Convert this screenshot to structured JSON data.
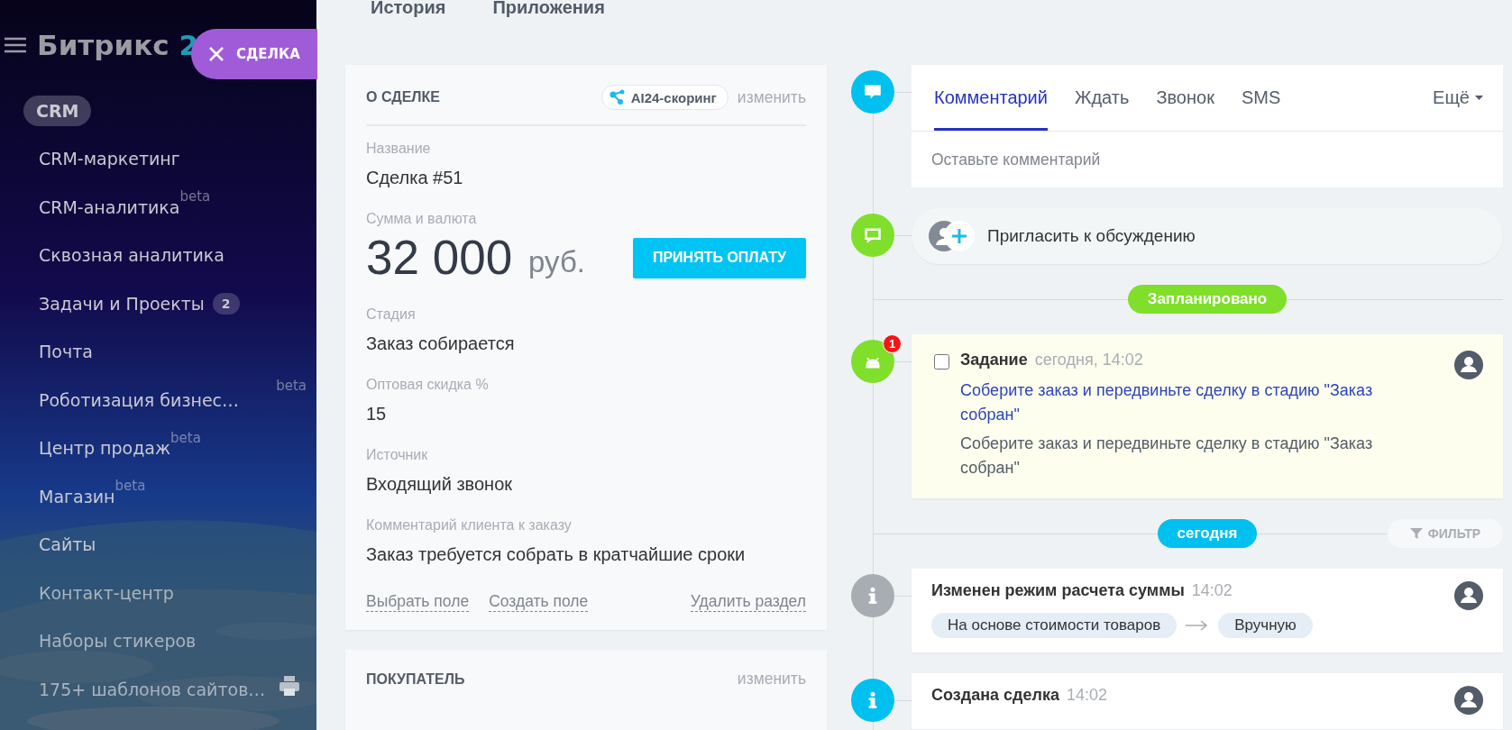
{
  "sidebar": {
    "logo": {
      "title": "Битрикс",
      "number": "2"
    },
    "items": [
      {
        "label": "CRM",
        "selected": true,
        "dimmed": false
      },
      {
        "label": "CRM-маркетинг",
        "selected": false,
        "dimmed": false
      },
      {
        "label": "CRM-аналитика",
        "superscript": "beta",
        "selected": false,
        "dimmed": false
      },
      {
        "label": "Сквозная аналитика",
        "selected": false,
        "dimmed": false
      },
      {
        "label": "Задачи и Проекты",
        "counter": "2",
        "selected": false,
        "dimmed": false
      },
      {
        "label": "Почта",
        "selected": false,
        "dimmed": false
      },
      {
        "label": "Роботизация бизнес…",
        "superscript": "beta",
        "superscript_right": true,
        "selected": false,
        "dimmed": false
      },
      {
        "label": "Центр продаж",
        "superscript": "beta",
        "selected": false,
        "dimmed": false
      },
      {
        "label": "Магазин",
        "superscript": "beta",
        "selected": false,
        "dimmed": false
      },
      {
        "label": "Сайты",
        "selected": false,
        "dimmed": false
      },
      {
        "label": "Контакт-центр",
        "selected": false,
        "dimmed": true
      },
      {
        "label": "Наборы стикеров",
        "selected": false,
        "dimmed": true
      },
      {
        "label": "175+ шаблонов сайтов…",
        "selected": false,
        "dimmed": true,
        "print_icon": true
      }
    ]
  },
  "deal_button": {
    "label": "СДЕЛКА"
  },
  "top_tabs": [
    "История",
    "Приложения"
  ],
  "deal_card": {
    "title": "О СДЕЛКЕ",
    "scoring": "AI24-скоринг",
    "edit": "изменить",
    "fields": [
      {
        "kind": "text",
        "label": "Название",
        "value": "Сделка #51"
      },
      {
        "kind": "amount",
        "label": "Сумма и валюта",
        "value": "32 000",
        "currency": "руб.",
        "button": "ПРИНЯТЬ ОПЛАТУ"
      },
      {
        "kind": "text",
        "label": "Стадия",
        "value": "Заказ собирается"
      },
      {
        "kind": "text",
        "label": "Оптовая скидка %",
        "value": "15"
      },
      {
        "kind": "text",
        "label": "Источник",
        "value": "Входящий звонок"
      },
      {
        "kind": "text",
        "label": "Комментарий клиента к заказу",
        "value": "Заказ требуется собрать в кратчайшие сроки"
      }
    ],
    "actions": [
      "Выбрать поле",
      "Создать поле"
    ],
    "delete": "Удалить раздел"
  },
  "buyer_card": {
    "title": "ПОКУПАТЕЛЬ",
    "edit": "изменить"
  },
  "timeline": [
    {
      "kind": "composer",
      "color": "#00c0ef",
      "tabs": [
        {
          "label": "Комментарий",
          "selected": true
        },
        {
          "label": "Ждать",
          "selected": false
        },
        {
          "label": "Звонок",
          "selected": false
        },
        {
          "label": "SMS",
          "selected": false
        }
      ],
      "more": "Ещё",
      "placeholder": "Оставьте комментарий"
    },
    {
      "kind": "invite",
      "color": "#7fdf2a",
      "label": "Пригласить к обсуждению"
    },
    {
      "kind": "divider",
      "color": "#7fdf2a",
      "label": "Запланировано"
    },
    {
      "kind": "task",
      "color": "#7fdf2a",
      "counter": "1",
      "checked": false,
      "title": "Задание",
      "time": "сегодня, 14:02",
      "link": "Соберите заказ и передвиньте сделку в стадию \"Заказ собран\"",
      "text": "Соберите заказ и передвиньте сделку в стадию \"Заказ собран\""
    },
    {
      "kind": "divider",
      "color": "#00c0ef",
      "label": "сегодня",
      "filter": "ФИЛЬТР"
    },
    {
      "kind": "event",
      "color": "#a8adb4",
      "title": "Изменен режим расчета суммы",
      "time": "14:02",
      "from": "На основе стоимости товаров",
      "to": "Вручную"
    },
    {
      "kind": "event",
      "color": "#00c0ef",
      "title": "Создана сделка",
      "time": "14:02"
    }
  ]
}
